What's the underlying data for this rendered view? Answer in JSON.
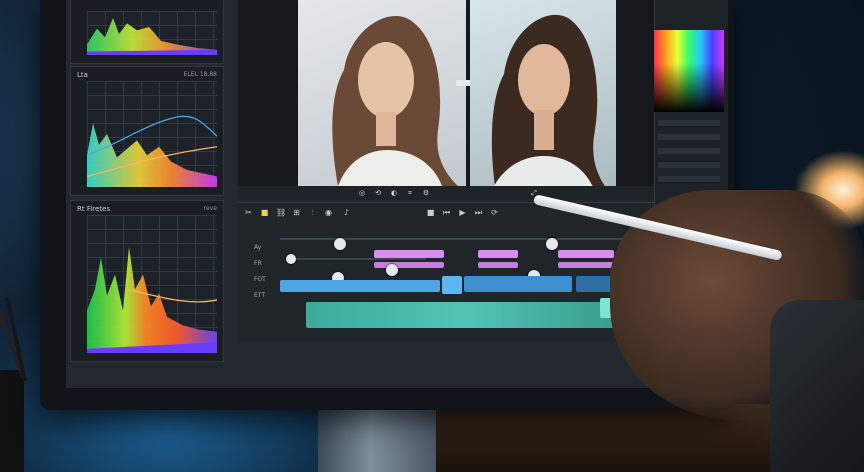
{
  "scene": {
    "description_free": true
  },
  "left_panels": [
    {
      "title": "",
      "value": ""
    },
    {
      "title": "Lta",
      "value": "ELEL 18.88"
    },
    {
      "title": "Rt Firetes",
      "value": "reve"
    }
  ],
  "viewer": {
    "split_handle": "split-view-handle"
  },
  "timeline": {
    "tracks": [
      {
        "label": "",
        "value": ""
      },
      {
        "label": "Ay",
        "value": ""
      },
      {
        "label": "FR",
        "value": ""
      },
      {
        "label": "FOT",
        "value": ""
      },
      {
        "label": "ETT",
        "value": ""
      }
    ]
  },
  "right_column": {
    "labels": [
      "",
      "",
      "",
      "",
      "",
      ""
    ]
  },
  "colors": {
    "accent_pink": "#d98cf0",
    "accent_blue": "#4fa6e6",
    "accent_teal": "#58d6c4"
  }
}
